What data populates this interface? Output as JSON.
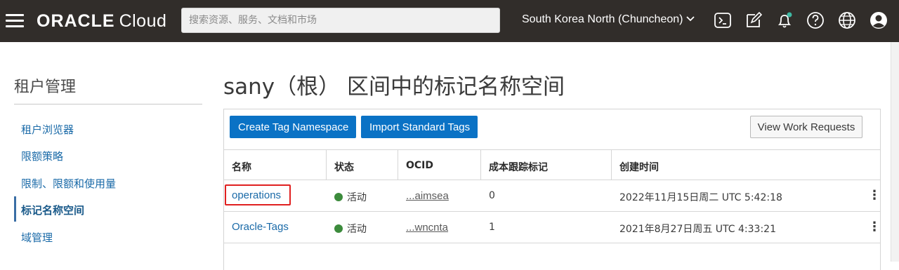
{
  "topbar": {
    "brand": "ORACLE",
    "product": "Cloud",
    "search_placeholder": "搜索资源、服务、文档和市场",
    "region": "South Korea North (Chuncheon)",
    "background_color": "#312d2a"
  },
  "sidebar": {
    "title": "租户管理",
    "items": [
      {
        "label": "租户浏览器"
      },
      {
        "label": "限额策略"
      },
      {
        "label": "限制、限额和使用量"
      },
      {
        "label": "标记名称空间",
        "active": true
      },
      {
        "label": "域管理"
      }
    ]
  },
  "main": {
    "title": "sany（根） 区间中的标记名称空间",
    "buttons": {
      "create": "Create Tag Namespace",
      "import": "Import Standard Tags",
      "work_requests": "View Work Requests"
    },
    "accent_color": "#0a72c5",
    "table": {
      "columns": [
        "名称",
        "状态",
        "OCID",
        "成本跟踪标记",
        "创建时间"
      ],
      "rows": [
        {
          "name": "operations",
          "status": "活动",
          "ocid": "...aimsea",
          "cost_tracking": "0",
          "created": "2022年11月15日周二 UTC 5:42:18",
          "highlighted": true
        },
        {
          "name": "Oracle-Tags",
          "status": "活动",
          "ocid": "...wncnta",
          "cost_tracking": "1",
          "created": "2021年8月27日周五 UTC 4:33:21",
          "highlighted": false
        }
      ]
    }
  }
}
